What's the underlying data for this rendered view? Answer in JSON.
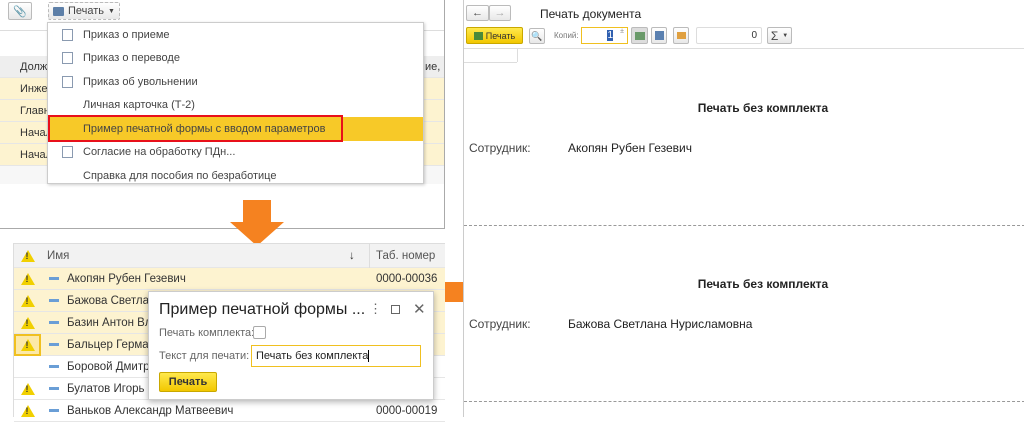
{
  "top_panel": {
    "print_button": "Печать",
    "table_header": [
      "Долж",
      "ие,"
    ],
    "table_rows": [
      "Инже",
      "Главн",
      "Начал",
      "Начал"
    ],
    "menu": [
      {
        "label": "Приказ о приеме",
        "icon": "document-export-icon"
      },
      {
        "label": "Приказ о переводе",
        "icon": "document-export-icon"
      },
      {
        "label": "Приказ об увольнении",
        "icon": "document-export-icon"
      },
      {
        "label": "Личная карточка (Т-2)",
        "icon": ""
      },
      {
        "label": "Пример печатной формы с вводом параметров",
        "icon": "",
        "highlighted": true
      },
      {
        "label": "Согласие на обработку ПДн...",
        "icon": "document-export-icon"
      },
      {
        "label": "Справка для пособия по безработице",
        "icon": ""
      }
    ]
  },
  "list": {
    "columns": {
      "name": "Имя",
      "tab": "Таб. номер",
      "sort": "↓"
    },
    "rows": [
      {
        "name": "Акопян Рубен Гезевич",
        "tab": "0000-00036",
        "warn": true,
        "selected": true
      },
      {
        "name": "Бажова Светлана",
        "tab": "",
        "warn": true,
        "selected": true
      },
      {
        "name": "Базин Антон Вла",
        "tab": "",
        "warn": true,
        "selected": true
      },
      {
        "name": "Бальцер Герман",
        "tab": "",
        "warn": true,
        "selected": true
      },
      {
        "name": "Боровой Дмитрий",
        "tab": "",
        "warn": false,
        "selected": false
      },
      {
        "name": "Булатов Игорь В",
        "tab": "",
        "warn": true,
        "selected": false
      },
      {
        "name": "Ваньков Александр Матвеевич",
        "tab": "0000-00019",
        "warn": true,
        "selected": false
      }
    ]
  },
  "dialog": {
    "title": "Пример печатной формы ...",
    "checkbox_label": "Печать комплекта:",
    "checkbox_checked": false,
    "text_label": "Текст для печати:",
    "text_value": "Печать без комплекта",
    "print_button": "Печать"
  },
  "preview": {
    "title": "Печать документа",
    "print_button": "Печать",
    "copies_label": "Копий:",
    "copies_value": "1",
    "sum_value": "0",
    "sum_icon": "Σ",
    "pages": [
      {
        "heading": "Печать без комплекта",
        "label": "Сотрудник:",
        "employee": "Акопян Рубен Гезевич"
      },
      {
        "heading": "Печать без комплекта",
        "label": "Сотрудник:",
        "employee": "Бажова Светлана Нурисламовна"
      }
    ]
  },
  "colors": {
    "accent": "#f5c518",
    "arrow": "#f58220",
    "highlight_box": "#e8101a",
    "row_selected": "#fdf3d0"
  }
}
